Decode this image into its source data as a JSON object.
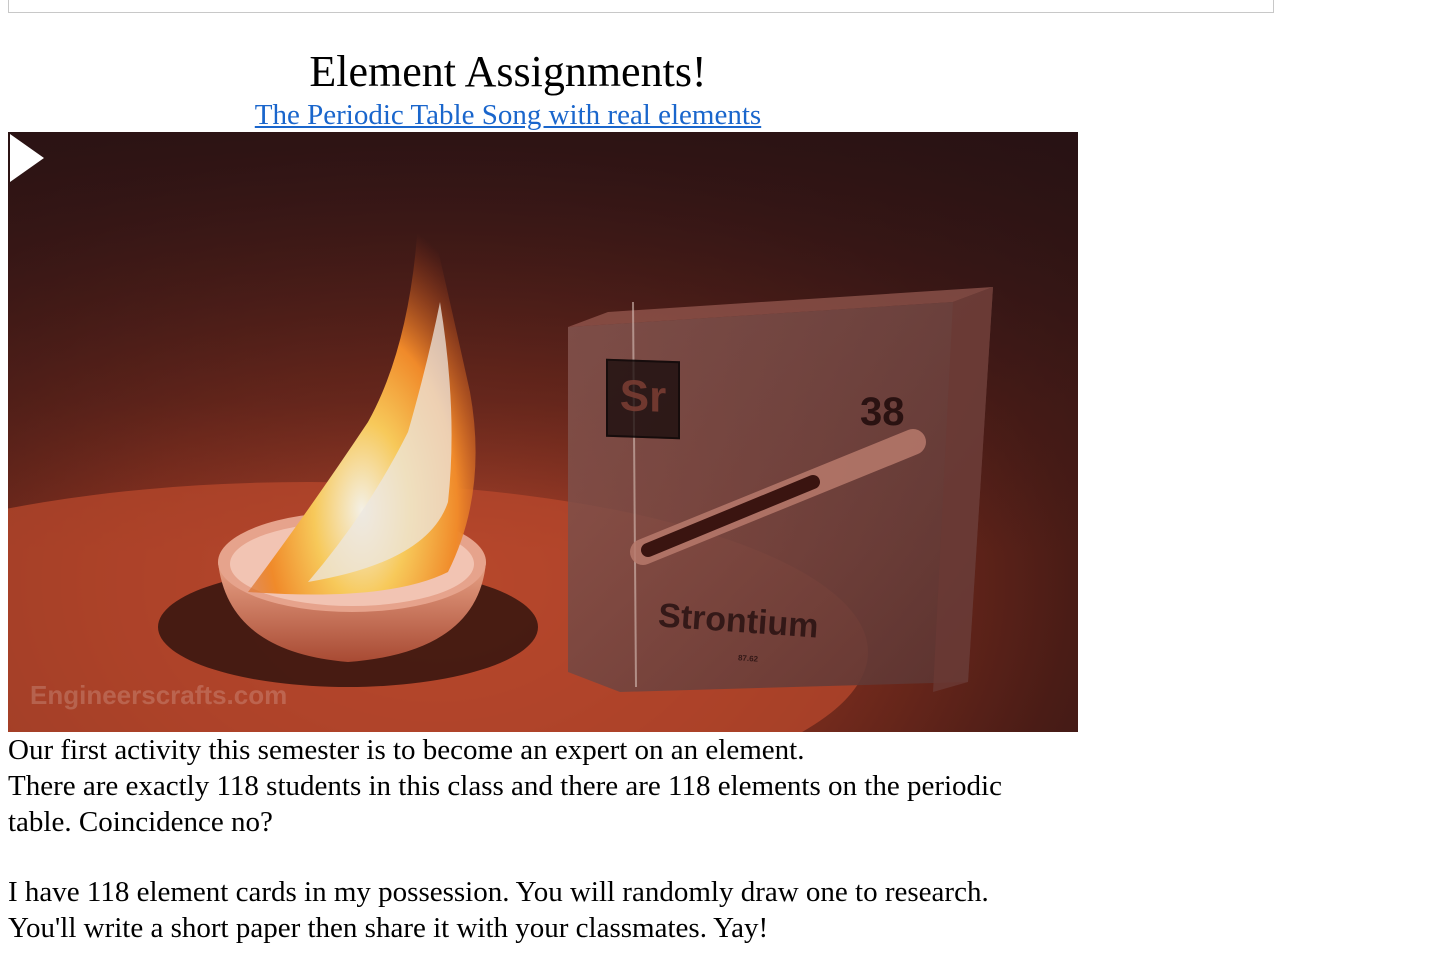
{
  "page": {
    "title": "Element Assignments!",
    "video_link_text": "The Periodic Table Song with real elements"
  },
  "video": {
    "thumbnail_description_icon": "video-thumbnail",
    "play_icon": "play-icon",
    "element_symbol": "Sr",
    "element_number": "38",
    "element_name": "Strontium",
    "element_mass": "87.62",
    "watermark": "Engineerscrafts.com"
  },
  "body": {
    "paragraph_1_line_1": "Our first activity this semester is to become an expert on an element.",
    "paragraph_1_line_2": "There are exactly 118 students in this class and there are 118 elements on the periodic table. Coincidence no?",
    "paragraph_2": "I have 118 element cards in my possession. You will randomly draw one to research. You'll write a short paper then share it with your classmates. Yay!"
  },
  "colors": {
    "link": "#1a66cc",
    "text": "#000000",
    "background": "#ffffff"
  }
}
